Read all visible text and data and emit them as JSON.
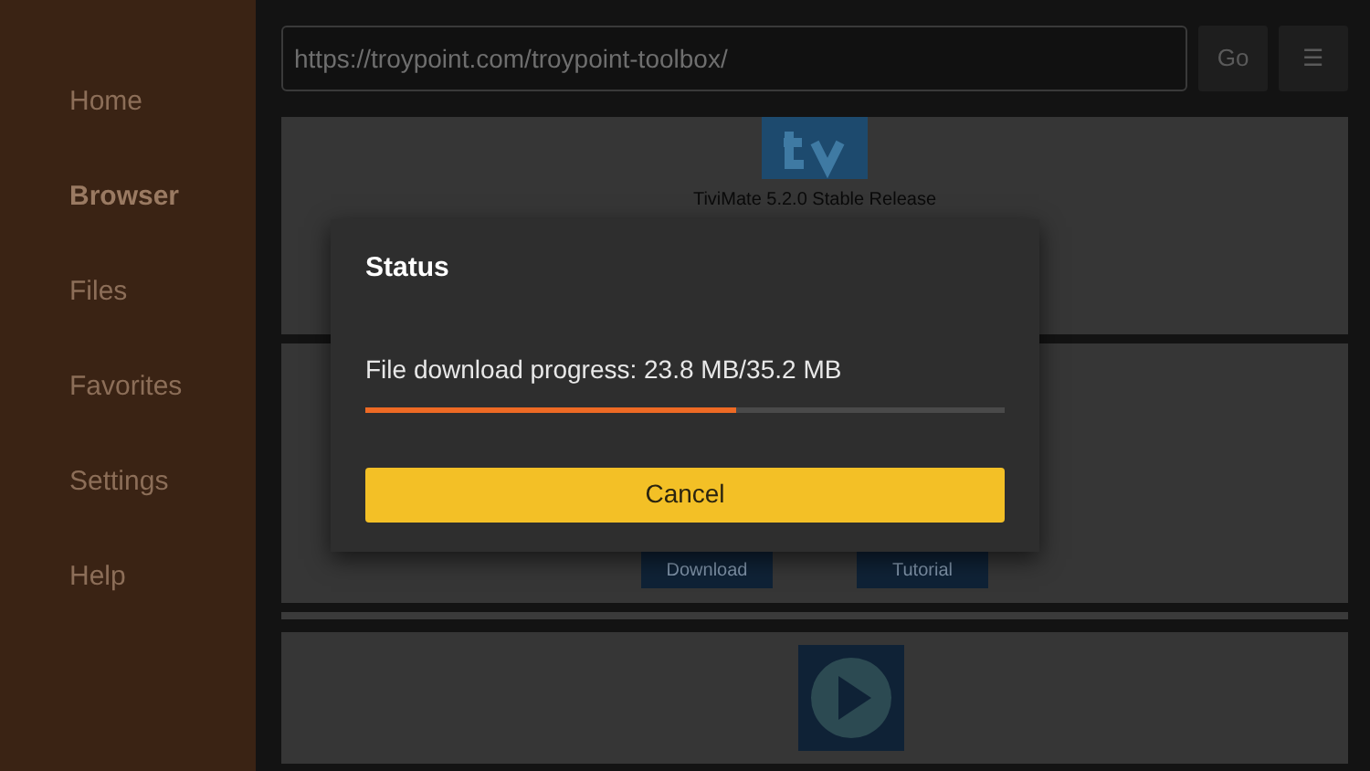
{
  "sidebar": {
    "items": [
      {
        "label": "Home",
        "selected": false
      },
      {
        "label": "Browser",
        "selected": true
      },
      {
        "label": "Files",
        "selected": false
      },
      {
        "label": "Favorites",
        "selected": false
      },
      {
        "label": "Settings",
        "selected": false
      },
      {
        "label": "Help",
        "selected": false
      }
    ]
  },
  "toolbar": {
    "url": "https://troypoint.com/troypoint-toolbox/",
    "go_button": "Go",
    "menu_button": "☰"
  },
  "cards": [
    {
      "kind": "app",
      "title": "TiviMate 5.2.0 Stable Release"
    },
    {
      "kind": "actions",
      "buttons": [
        "Download",
        "Tutorial"
      ]
    },
    {
      "kind": "player"
    }
  ],
  "dialog": {
    "title": "Status",
    "message": "File download progress: 23.8 MB/35.2 MB",
    "progress": {
      "level": 0.58
    },
    "button": "Cancel"
  }
}
